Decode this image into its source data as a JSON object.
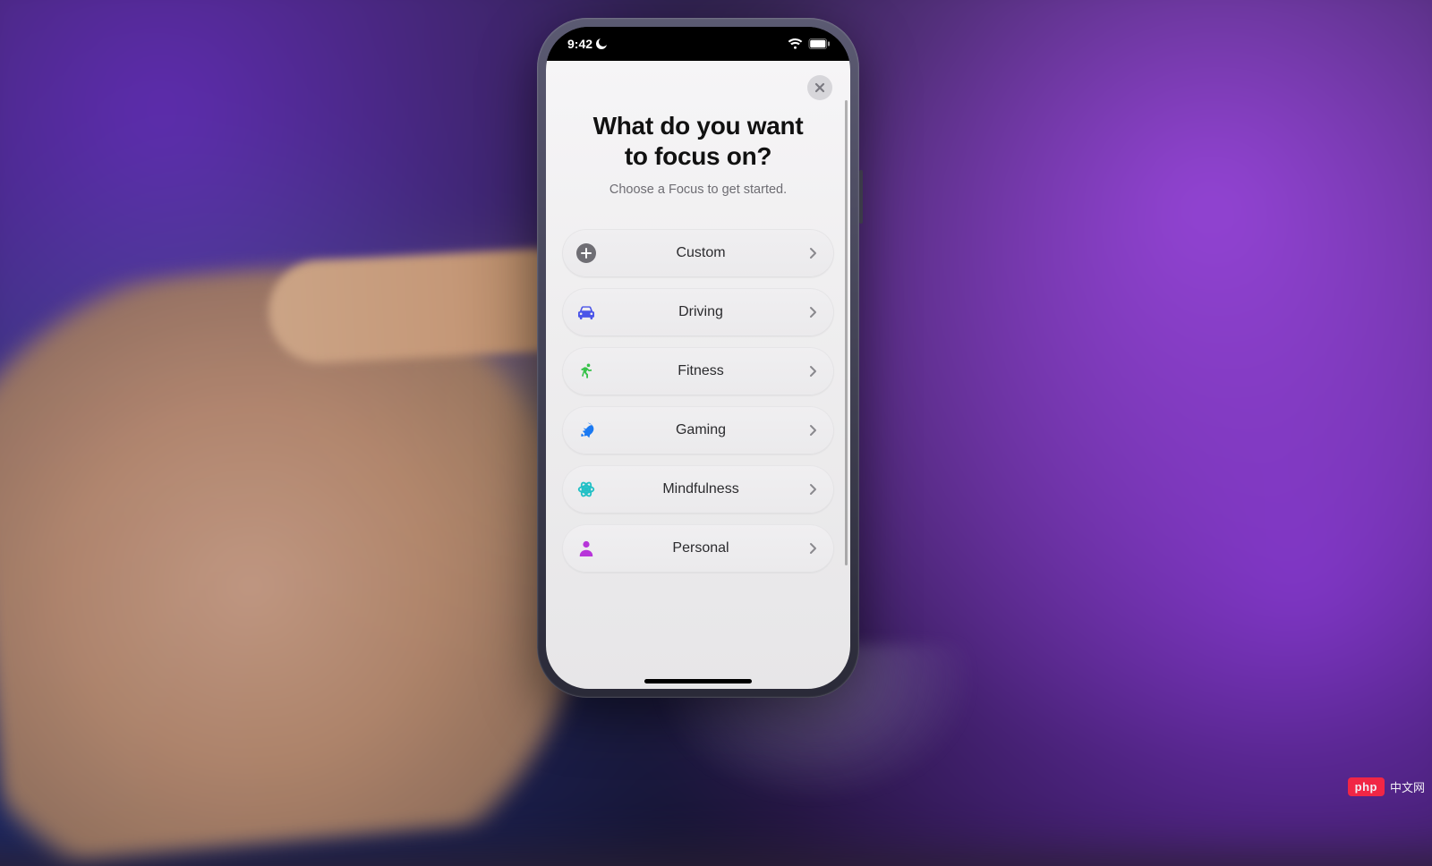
{
  "status": {
    "time": "9:42",
    "dnd": true,
    "wifi": true,
    "battery_full": true
  },
  "sheet": {
    "title_line1": "What do you want",
    "title_line2": "to focus on?",
    "subtitle": "Choose a Focus to get started.",
    "options": [
      {
        "id": "custom",
        "label": "Custom",
        "icon": "plus-icon",
        "color": "#6f6e74"
      },
      {
        "id": "driving",
        "label": "Driving",
        "icon": "car-icon",
        "color": "#4b55e8"
      },
      {
        "id": "fitness",
        "label": "Fitness",
        "icon": "run-icon",
        "color": "#37c24a"
      },
      {
        "id": "gaming",
        "label": "Gaming",
        "icon": "rocket-icon",
        "color": "#1a79f2"
      },
      {
        "id": "mindfulness",
        "label": "Mindfulness",
        "icon": "mindfulness-icon",
        "color": "#22c0c6"
      },
      {
        "id": "personal",
        "label": "Personal",
        "icon": "person-icon",
        "color": "#b735d9"
      }
    ]
  },
  "watermark": {
    "badge": "php",
    "text": "中文网"
  }
}
